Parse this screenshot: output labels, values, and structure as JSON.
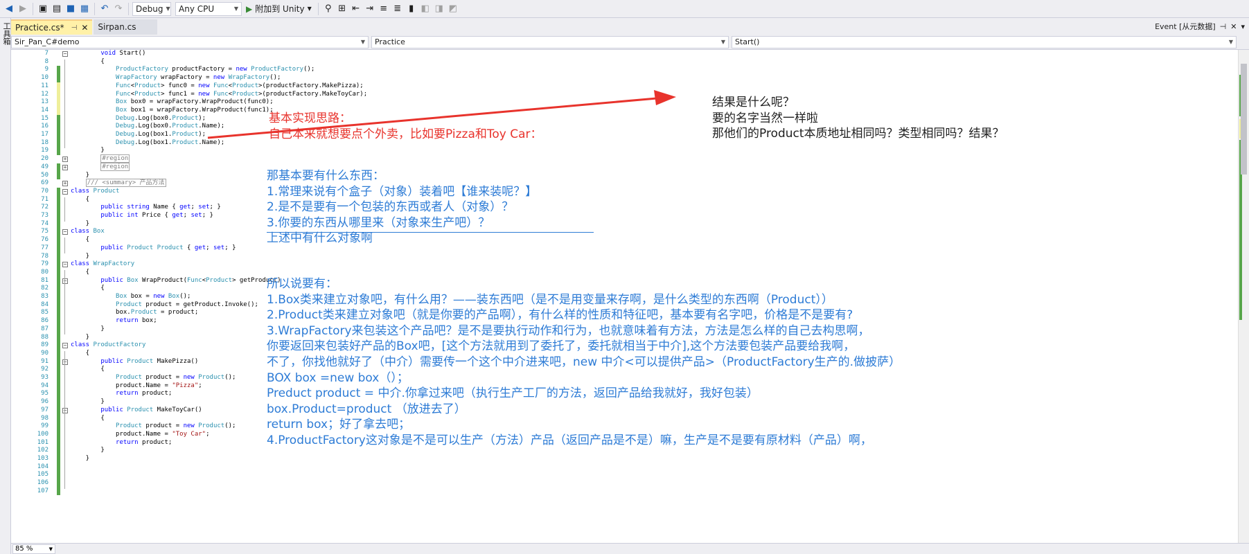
{
  "toolbar": {
    "config": "Debug",
    "platform": "Any CPU",
    "run_label": "附加到 Unity"
  },
  "left_strip": {
    "label": "工具箱"
  },
  "tabs": [
    {
      "label": "Practice.cs*"
    },
    {
      "label": "Sirpan.cs"
    }
  ],
  "event_tab": {
    "label": "Event [从元数据]"
  },
  "navbar": {
    "project": "Sir_Pan_C#demo",
    "class": "Practice",
    "member": "Start()"
  },
  "line_numbers": [
    "7",
    "8",
    "9",
    "10",
    "11",
    "12",
    "13",
    "14",
    "15",
    "16",
    "17",
    "18",
    "19",
    "20",
    "49",
    "50",
    "69",
    "70",
    "71",
    "72",
    "73",
    "74",
    "75",
    "76",
    "77",
    "78",
    "79",
    "80",
    "81",
    "82",
    "83",
    "84",
    "85",
    "86",
    "87",
    "88",
    "89",
    "90",
    "91",
    "92",
    "93",
    "94",
    "95",
    "96",
    "97",
    "98",
    "99",
    "100",
    "101",
    "102",
    "103",
    "104",
    "105",
    "106",
    "107"
  ],
  "code_lines": [
    "        void Start()",
    "        {",
    "            ProductFactory productFactory = new ProductFactory();",
    "            WrapFactory wrapFactory = new WrapFactory();",
    "            Func<Product> func0 = new Func<Product>(productFactory.MakePizza);",
    "            Func<Product> func1 = new Func<Product>(productFactory.MakeToyCar);",
    "            Box box0 = wrapFactory.WrapProduct(func0);",
    "            Box box1 = wrapFactory.WrapProduct(func1);",
    "            Debug.Log(box0.Product);",
    "            Debug.Log(box0.Product.Name);",
    "            Debug.Log(box1.Product);",
    "            Debug.Log(box1.Product.Name);",
    "        }",
    "        #region",
    "        #region",
    "    }",
    "    /// <summary> 产品方法",
    "class Product",
    "    {",
    "        public string Name { get; set; }",
    "        public int Price { get; set; }",
    "    }",
    "class Box",
    "    {",
    "        public Product Product { get; set; }",
    "    }",
    "class WrapFactory",
    "    {",
    "        public Box WrapProduct(Func<Product> getProduct)",
    "        {",
    "            Box box = new Box();",
    "            Product product = getProduct.Invoke();",
    "            box.Product = product;",
    "            return box;",
    "        }",
    "    }",
    "class ProductFactory",
    "    {",
    "        public Product MakePizza()",
    "        {",
    "            Product product = new Product();",
    "            product.Name = \"Pizza\";",
    "            return product;",
    "        }",
    "        public Product MakeToyCar()",
    "        {",
    "            Product product = new Product();",
    "            product.Name = \"Toy Car\";",
    "            return product;",
    "        }",
    "    }"
  ],
  "notes": {
    "red": [
      "基本实现思路：",
      "自己本来就想要点个外卖，比如要Pizza和Toy Car："
    ],
    "black": [
      "结果是什么呢？",
      "要的名字当然一样啦",
      "那他们的Product本质地址相同吗？类型相同吗？结果？"
    ],
    "blue_top": [
      "那基本要有什么东西：",
      "1.常理来说有个盒子（对象）装着吧【谁来装呢？】",
      "2.是不是要有一个包装的东西或者人（对象）？",
      "3.你要的东西从哪里来（对象来生产吧）？",
      "上述中有什么对象啊"
    ],
    "blue_bottom": [
      "所以说要有：",
      "1.Box类来建立对象吧，有什么用？——装东西吧（是不是用变量来存啊，是什么类型的东西啊（Product））",
      "2.Product类来建立对象吧（就是你要的产品啊），有什么样的性质和特征吧，基本要有名字吧，价格是不是要有?",
      "3.WrapFactory来包装这个产品吧？是不是要执行动作和行为，也就意味着有方法，方法是怎么样的自己去构思啊，",
      "   你要返回来包装好产品的Box吧，[这个方法就用到了委托了，委托就相当于中介],这个方法要包装产品要给我啊，",
      "   不了，你找他就好了（中介）需要传一个这个中介进来吧，new 中介<可以提供产品>（ProductFactory生产的.做披萨）",
      "   BOX box =new box（）；",
      "   Preduct product = 中介.你拿过来吧（执行生产工厂的方法，返回产品给我就好，我好包装）",
      "   box.Product=product （放进去了）",
      "   return box；好了拿去吧；",
      "4.ProductFactory这对象是不是可以生产（方法）产品（返回产品是不是）嘛，生产是不是要有原材料（产品）啊，"
    ]
  },
  "zoom": {
    "level": "85 %"
  },
  "colors": {
    "note_red": "#e8332c",
    "note_blue": "#2e7cd6",
    "keyword": "#0000ff",
    "type": "#2b91af",
    "string": "#a31515",
    "change_saved": "#57a64a",
    "change_unsaved": "#efef9a",
    "tab_active": "#fff1a8"
  }
}
